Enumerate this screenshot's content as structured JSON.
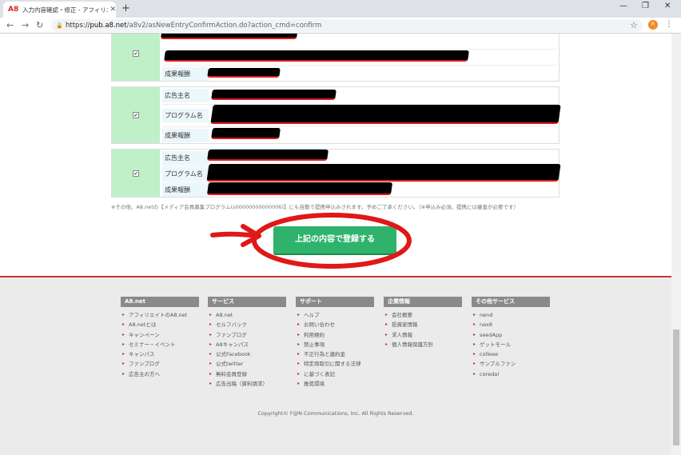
{
  "browser": {
    "tab_title": "入力内容確認・修正 - アフィリエイト",
    "tab_favicon": "A8",
    "new_tab": "+",
    "url_prefix": "https://",
    "url_host": "pub.a8.net",
    "url_path": "/a8v2/asNewEntryConfirmAction.do?action_cmd=confirm",
    "avatar_initial": "R",
    "icons": [
      "back-icon",
      "forward-icon",
      "reload-icon",
      "lock-icon",
      "star-icon",
      "kebab-menu-icon"
    ]
  },
  "entries": [
    {
      "labels": [
        "成果報酬"
      ]
    },
    {
      "labels": [
        "広告主名",
        "プログラム名",
        "成果報酬"
      ]
    },
    {
      "labels": [
        "広告主名",
        "プログラム名",
        "成果報酬"
      ]
    }
  ],
  "note": "※その他、A8.netの【メディア会員募集プログラム(s00000000000006)】にも自動で提携申込みされます。予めご了承ください。（※申込み必須。提携には審査が必要です）",
  "submit_label": "上記の内容で登録する",
  "footer": {
    "columns": [
      {
        "title": "A8.net",
        "items": [
          "アフィリエイトのA8.net",
          "A8.netとは",
          "キャンペーン",
          "セミナー・イベント",
          "キャンパス",
          "ファンブログ",
          "広告主の方へ"
        ]
      },
      {
        "title": "サービス",
        "items": [
          "A8.net",
          "セルフバック",
          "ファンブログ",
          "A8キャンパス",
          "公式Facebook",
          "公式twitter",
          "無料会員登録",
          "広告出稿（資料請求）"
        ]
      },
      {
        "title": "サポート",
        "items": [
          "ヘルプ",
          "お問い合わせ",
          "利用規約",
          "禁止事項",
          "不正行為と違約金",
          "特定商取引に関する法律",
          "に基づく表記",
          "推奨環境"
        ]
      },
      {
        "title": "企業情報",
        "items": [
          "会社概要",
          "投資家情報",
          "求人情報",
          "個人情報保護方針"
        ]
      },
      {
        "title": "その他サービス",
        "items": [
          "nend",
          "nex8",
          "seedApp",
          "ゲットモール",
          "colleee",
          "サンプルファン",
          "coreda!"
        ]
      }
    ],
    "copyright": "Copyright© F@N Communications, Inc. All Rights Reserved."
  },
  "colors": {
    "accent": "#2fb36c",
    "annotation": "#e01818",
    "footer_rule": "#cc3333"
  }
}
